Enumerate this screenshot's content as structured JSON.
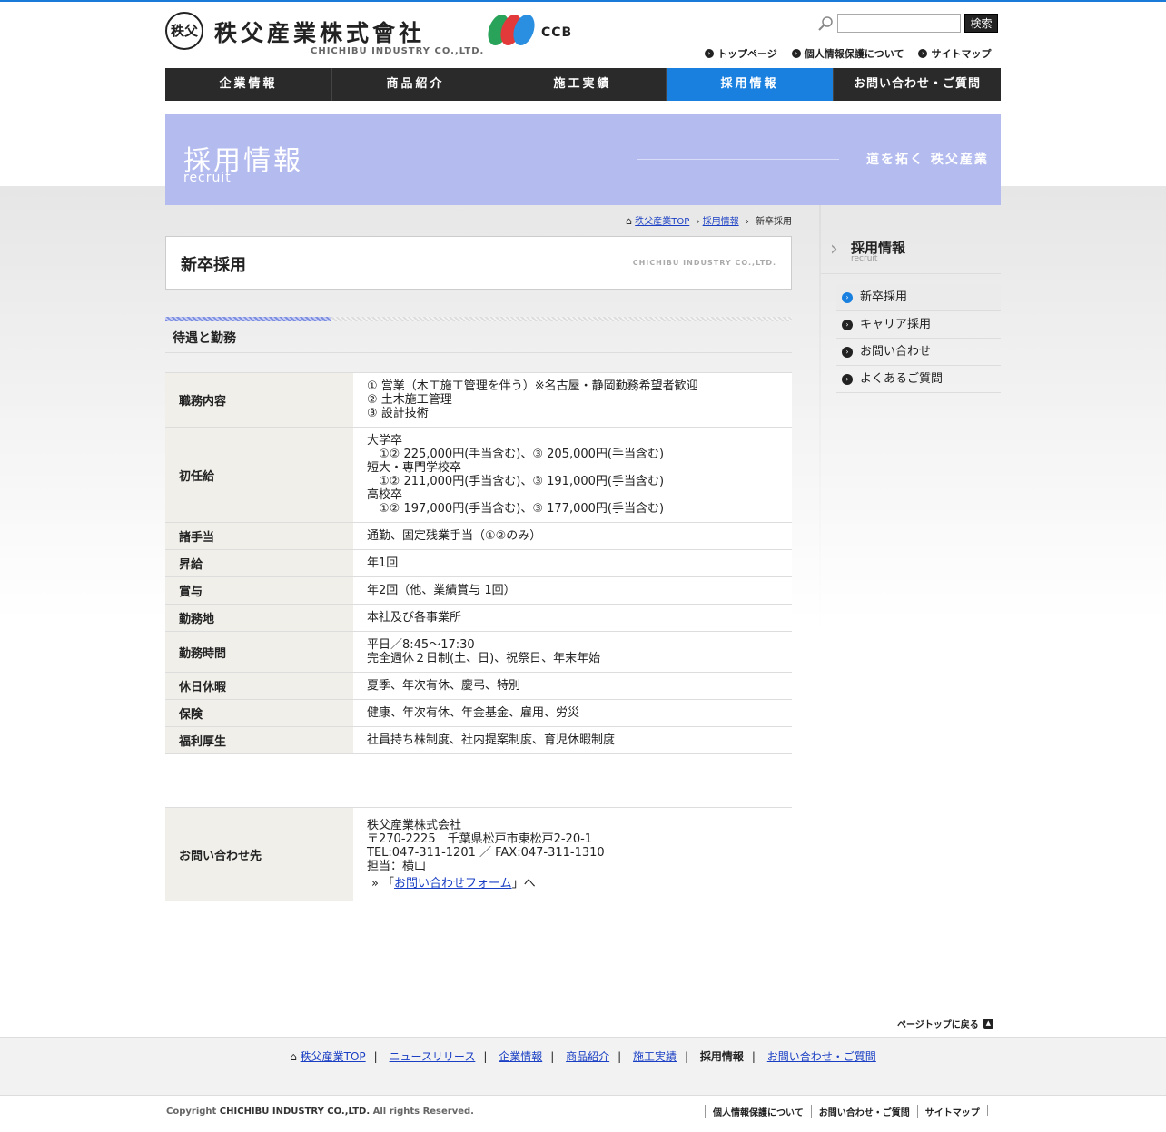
{
  "header": {
    "logo_mark": "秩父",
    "logo_name": "秩父産業株式會社",
    "logo_en": "CHICHIBU INDUSTRY CO.,LTD.",
    "ccb_text": "CCB",
    "search_button": "検索",
    "search_placeholder": "",
    "top_links": [
      "トップページ",
      "個人情報保護について",
      "サイトマップ"
    ]
  },
  "nav": {
    "items": [
      "企業情報",
      "商品紹介",
      "施工実績",
      "採用情報",
      "お問い合わせ・ご質問"
    ],
    "active_index": 3
  },
  "banner": {
    "title": "採用情報",
    "subtitle": "recruit",
    "tagline": "道を拓く 秩父産業"
  },
  "breadcrumb": {
    "home": "秩父産業TOP",
    "parent": "採用情報",
    "current": "新卒採用"
  },
  "page": {
    "title": "新卒採用",
    "title_en": "CHICHIBU INDUSTRY CO.,LTD.",
    "section_heading": "待遇と勤務"
  },
  "table": {
    "rows": [
      {
        "label": "職務内容",
        "lines": [
          "① 営業（木工施工管理を伴う）※名古屋・静岡勤務希望者歓迎",
          "② 土木施工管理",
          "③ 設計技術"
        ]
      },
      {
        "label": "初任給",
        "lines": [
          "大学卒",
          "　①② 225,000円(手当含む)、③ 205,000円(手当含む)",
          "短大・専門学校卒",
          "　①② 211,000円(手当含む)、③ 191,000円(手当含む)",
          "高校卒",
          "　①② 197,000円(手当含む)、③ 177,000円(手当含む)"
        ]
      },
      {
        "label": "諸手当",
        "lines": [
          "通勤、固定残業手当（①②のみ）"
        ]
      },
      {
        "label": "昇給",
        "lines": [
          "年1回"
        ]
      },
      {
        "label": "賞与",
        "lines": [
          "年2回（他、業績賞与 1回）"
        ]
      },
      {
        "label": "勤務地",
        "lines": [
          "本社及び各事業所"
        ]
      },
      {
        "label": "勤務時間",
        "lines": [
          "平日／8:45～17:30",
          "完全週休２日制(土、日)、祝祭日、年末年始"
        ]
      },
      {
        "label": "休日休暇",
        "lines": [
          "夏季、年次有休、慶弔、特別"
        ]
      },
      {
        "label": "保険",
        "lines": [
          "健康、年次有休、年金基金、雇用、労災"
        ]
      },
      {
        "label": "福利厚生",
        "lines": [
          "社員持ち株制度、社内提案制度、育児休暇制度"
        ]
      }
    ]
  },
  "contact": {
    "label": "お問い合わせ先",
    "lines": [
      "秩父産業株式会社",
      "〒270-2225　千葉県松戸市東松戸2-20-1",
      "TEL:047-311-1201 ／ FAX:047-311-1310",
      "担当：横山"
    ],
    "link_prefix": "「",
    "link_text": "お問い合わせフォーム",
    "link_suffix": "」へ"
  },
  "sidebar": {
    "title": "採用情報",
    "subtitle": "recruit",
    "items": [
      "新卒採用",
      "キャリア採用",
      "お問い合わせ",
      "よくあるご質問"
    ],
    "current_index": 0
  },
  "footer": {
    "page_top": "ページトップに戻る",
    "nav": [
      "秩父産業TOP",
      "ニュースリリース",
      "企業情報",
      "商品紹介",
      "施工実績",
      "採用情報",
      "お問い合わせ・ご質問"
    ],
    "nav_current_index": 5,
    "copyright_prefix": "Copyright",
    "copyright_company": "CHICHIBU INDUSTRY CO.,LTD.",
    "copyright_suffix": "All rights Reserved.",
    "links": [
      "個人情報保護について",
      "お問い合わせ・ご質問",
      "サイトマップ"
    ]
  },
  "colors": {
    "accent": "#1a80e0",
    "banner": "#b4bbef",
    "nav_bg": "#2a2a2a"
  }
}
